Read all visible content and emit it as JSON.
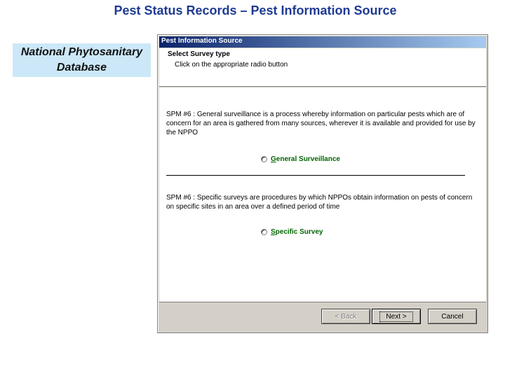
{
  "slide": {
    "title": "Pest Status Records – Pest Information Source",
    "side_label_line1": "National Phytosanitary",
    "side_label_line2": "Database"
  },
  "dialog": {
    "title": "Pest Information Source",
    "header_title": "Select Survey type",
    "header_subtitle": "Click on the appropriate radio button",
    "option1": {
      "description": "SPM #6 : General surveillance is a process whereby information on particular pests which are of concern for an area is gathered from many sources, wherever it is available and provided for use by the NPPO",
      "label_first": "G",
      "label_rest": "eneral Surveillance",
      "selected": false
    },
    "option2": {
      "description": "SPM #6 : Specific surveys are procedures by which NPPOs obtain information on pests of concern on specific sites in an area over a defined period of time",
      "label_first": "S",
      "label_rest": "pecific Survey",
      "selected": false
    },
    "buttons": {
      "back": "< Back",
      "next": "Next >",
      "cancel": "Cancel"
    }
  },
  "colors": {
    "slide_title": "#1f3a93",
    "side_label_bg": "#cce8f8",
    "titlebar_start": "#0a246a",
    "titlebar_end": "#a6caf0",
    "option_label": "#006400"
  }
}
